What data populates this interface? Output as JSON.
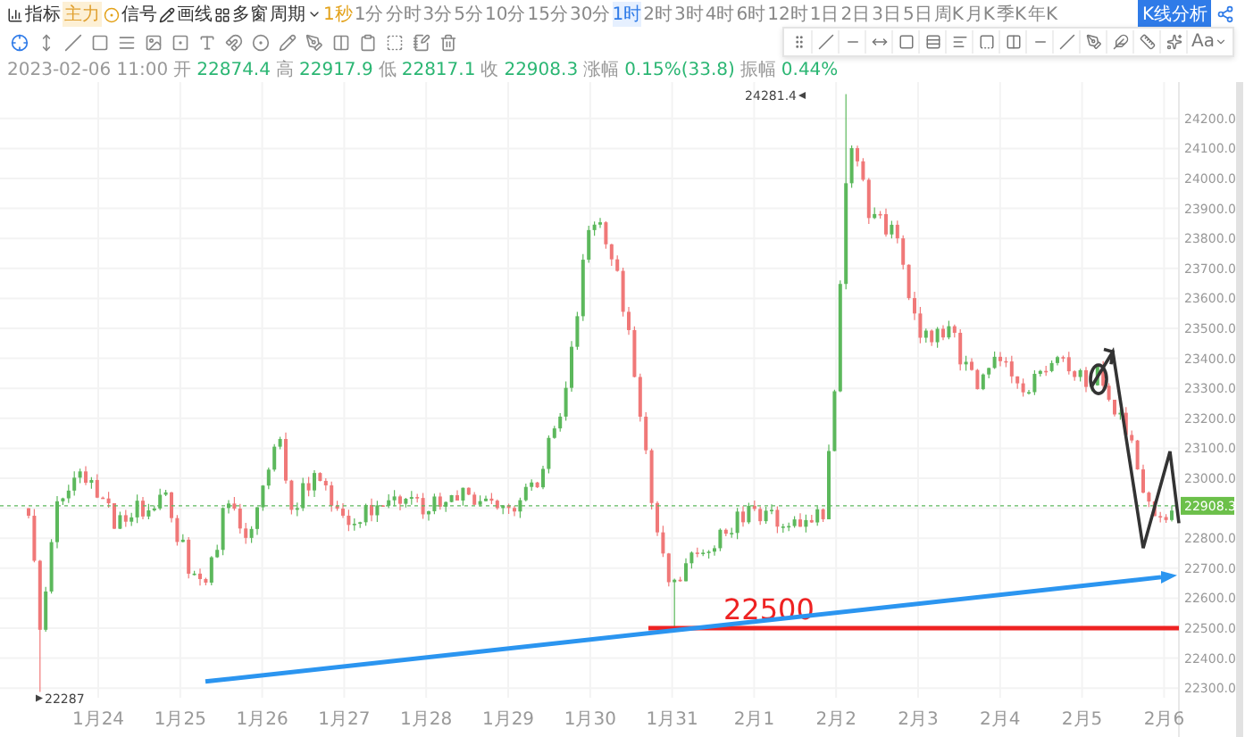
{
  "menu": [
    {
      "kind": "indicator",
      "label": "指标",
      "badge": "主力"
    },
    {
      "kind": "signal",
      "label": "信号"
    },
    {
      "kind": "draw",
      "label": "画线"
    },
    {
      "kind": "windows",
      "label": "多窗"
    },
    {
      "kind": "period",
      "label": "周期"
    }
  ],
  "periods": [
    {
      "label": "1秒",
      "selected": false,
      "highlighted": true
    },
    {
      "label": "1分",
      "selected": false,
      "highlighted": false
    },
    {
      "label": "分时",
      "selected": false,
      "highlighted": false
    },
    {
      "label": "3分",
      "selected": false,
      "highlighted": false
    },
    {
      "label": "5分",
      "selected": false,
      "highlighted": false
    },
    {
      "label": "10分",
      "selected": false,
      "highlighted": false
    },
    {
      "label": "15分",
      "selected": false,
      "highlighted": false
    },
    {
      "label": "30分",
      "selected": false,
      "highlighted": false
    },
    {
      "label": "1时",
      "selected": true,
      "highlighted": false
    },
    {
      "label": "2时",
      "selected": false,
      "highlighted": false
    },
    {
      "label": "3时",
      "selected": false,
      "highlighted": false
    },
    {
      "label": "4时",
      "selected": false,
      "highlighted": false
    },
    {
      "label": "6时",
      "selected": false,
      "highlighted": false
    },
    {
      "label": "12时",
      "selected": false,
      "highlighted": false
    },
    {
      "label": "1日",
      "selected": false,
      "highlighted": false
    },
    {
      "label": "2日",
      "selected": false,
      "highlighted": false
    },
    {
      "label": "3日",
      "selected": false,
      "highlighted": false
    },
    {
      "label": "5日",
      "selected": false,
      "highlighted": false
    },
    {
      "label": "周K",
      "selected": false,
      "highlighted": false
    },
    {
      "label": "月K",
      "selected": false,
      "highlighted": false
    },
    {
      "label": "季K",
      "selected": false,
      "highlighted": false
    },
    {
      "label": "年K",
      "selected": false,
      "highlighted": false
    }
  ],
  "analysis_button": "K线分析",
  "tools": [
    {
      "selected": true
    },
    {
      "selected": false
    },
    {
      "selected": false
    },
    {
      "selected": false
    },
    {
      "selected": false
    },
    {
      "selected": false
    },
    {
      "selected": false
    },
    {
      "selected": false
    },
    {
      "selected": false
    },
    {
      "selected": false
    },
    {
      "selected": false
    },
    {
      "selected": false
    },
    {
      "selected": false
    },
    {
      "selected": false
    },
    {
      "selected": false
    },
    {
      "selected": false
    },
    {
      "selected": false
    }
  ],
  "draw_toolbar": {
    "font_button": "Aa"
  },
  "info": {
    "time": "2023-02-06 11:00",
    "fields": [
      {
        "label": "开",
        "value": "22874.4"
      },
      {
        "label": "高",
        "value": "22917.9"
      },
      {
        "label": "低",
        "value": "22817.1"
      },
      {
        "label": "收",
        "value": "22908.3"
      },
      {
        "label": "涨幅",
        "value": "0.15%(33.8)"
      },
      {
        "label": "振幅",
        "value": "0.44%"
      }
    ]
  },
  "chart": {
    "price_axis_upper": [
      "24200.0",
      "24100.0",
      "24000.0",
      "23900.0",
      "23800.0",
      "23700.0",
      "23600.0",
      "23500.0",
      "23400.0",
      "23300.0",
      "23200.0",
      "23100.0",
      "23000.0"
    ],
    "price_axis_lower": [
      "22800.0",
      "22700.0",
      "22600.0",
      "22500.0",
      "22400.0",
      "22300.0"
    ],
    "date_axis": [
      "1月24",
      "1月25",
      "1月26",
      "1月27",
      "1月28",
      "1月29",
      "1月30",
      "1月31",
      "2月1",
      "2月2",
      "2月3",
      "2月4",
      "2月5",
      "2月6"
    ],
    "high_marker": "24281.4",
    "low_marker": "22287",
    "current_price": "22908.3",
    "level_label": "22500"
  }
}
